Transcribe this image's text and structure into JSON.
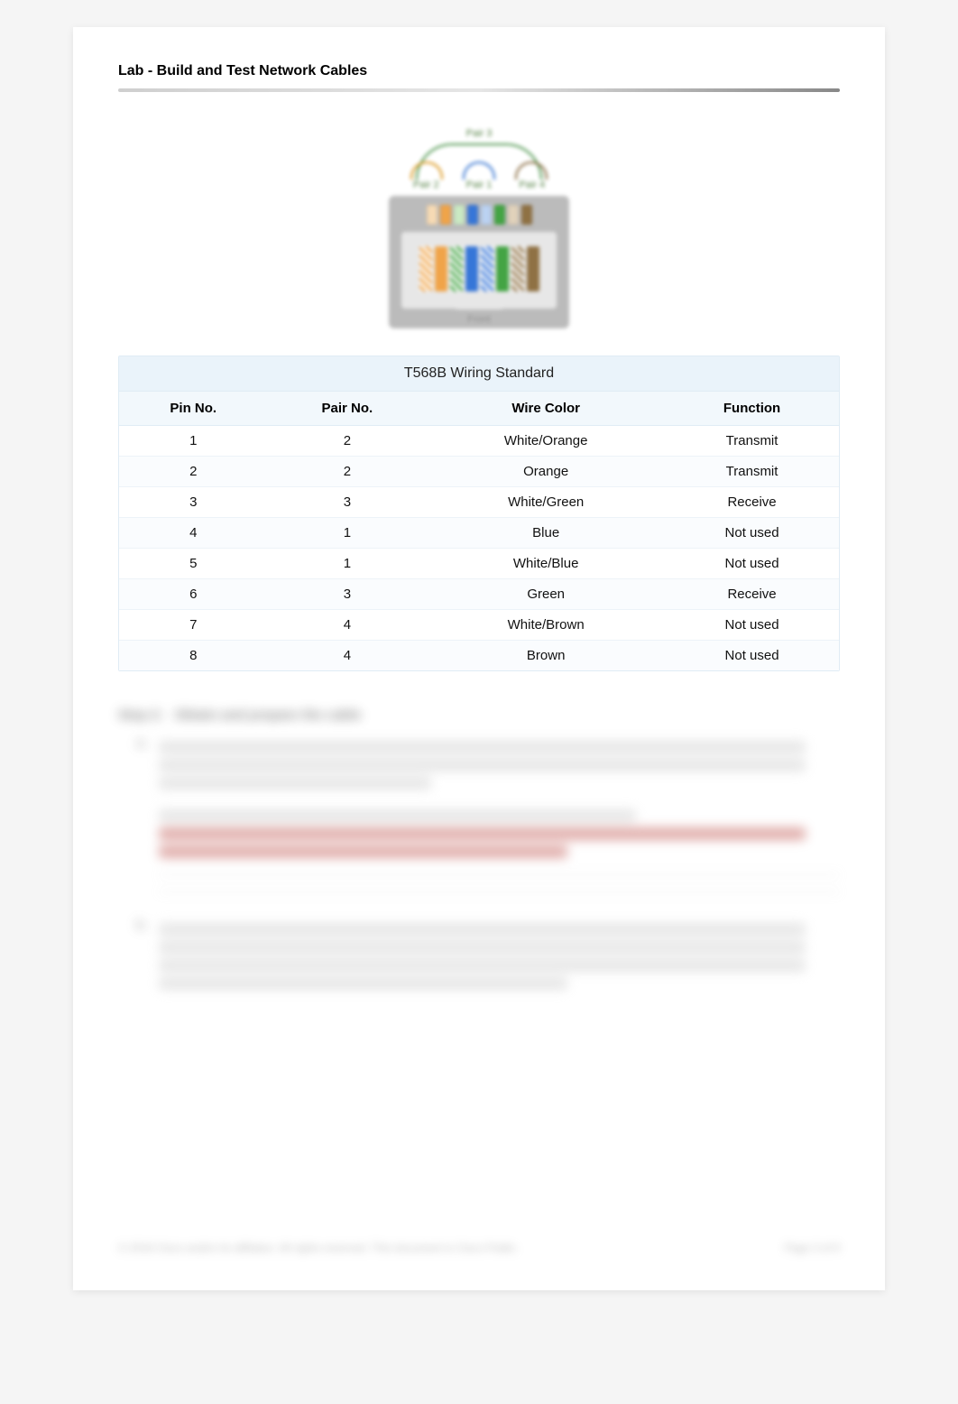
{
  "header": {
    "title": "Lab - Build and Test Network Cables"
  },
  "diagram": {
    "top_pair_label": "Pair 3",
    "sub_pair_labels": [
      "Pair 2",
      "Pair 1",
      "Pair 4"
    ],
    "front_label": "Front"
  },
  "table": {
    "title": "T568B Wiring Standard",
    "columns": [
      "Pin No.",
      "Pair No.",
      "Wire Color",
      "Function"
    ],
    "rows": [
      {
        "pin": "1",
        "pair": "2",
        "color": "White/Orange",
        "func": "Transmit"
      },
      {
        "pin": "2",
        "pair": "2",
        "color": "Orange",
        "func": "Transmit"
      },
      {
        "pin": "3",
        "pair": "3",
        "color": "White/Green",
        "func": "Receive"
      },
      {
        "pin": "4",
        "pair": "1",
        "color": "Blue",
        "func": "Not used"
      },
      {
        "pin": "5",
        "pair": "1",
        "color": "White/Blue",
        "func": "Not used"
      },
      {
        "pin": "6",
        "pair": "3",
        "color": "Green",
        "func": "Receive"
      },
      {
        "pin": "7",
        "pair": "4",
        "color": "White/Brown",
        "func": "Not used"
      },
      {
        "pin": "8",
        "pair": "4",
        "color": "Brown",
        "func": "Not used"
      }
    ]
  },
  "wire_colors_css": [
    "repeating-linear-gradient(45deg,#fff,#fff 3px,#f0a040 3px,#f0a040 6px)",
    "#f0a040",
    "repeating-linear-gradient(45deg,#fff,#fff 3px,#3aa03a 3px,#3aa03a 6px)",
    "#2c6fd6",
    "repeating-linear-gradient(45deg,#fff,#fff 3px,#2c6fd6 3px,#2c6fd6 6px)",
    "#3aa03a",
    "repeating-linear-gradient(45deg,#fff,#fff 3px,#8a6a3a 3px,#8a6a3a 6px)",
    "#8a6a3a"
  ],
  "pin_colors_css": [
    "#f7d9b0",
    "#f0a040",
    "#c8e8c0",
    "#2c6fd6",
    "#b8d0f2",
    "#3aa03a",
    "#e0d0b8",
    "#8a6a3a"
  ],
  "footer": {
    "left": "© 2018 Cisco and/or its affiliates. All rights reserved. This document is Cisco Public.",
    "right": "Page 3 of 9"
  }
}
